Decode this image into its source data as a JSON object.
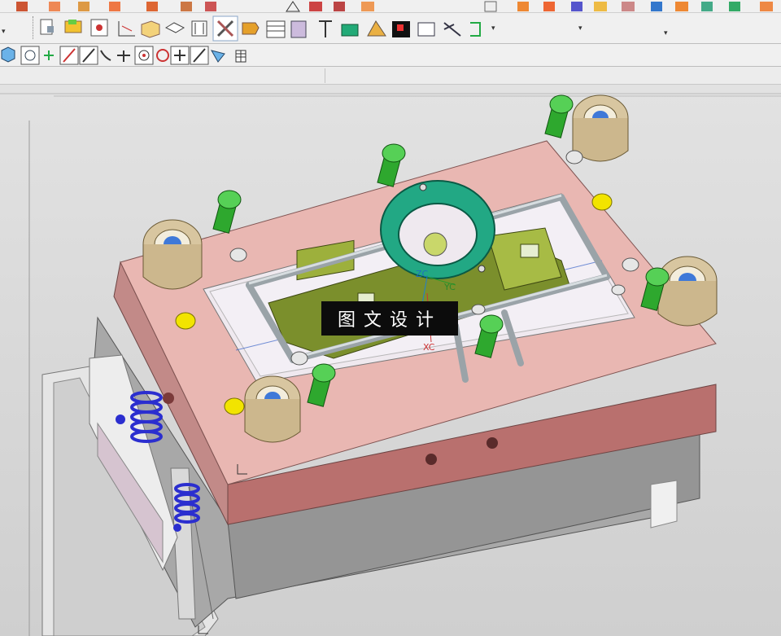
{
  "toolbar_row1": {
    "icons": [
      "mold-wizard-icon",
      "close-part-icon",
      "copy-part-icon",
      "layer-icon",
      "assembly-icon",
      "move-icon",
      "clone-icon",
      "sketch-icon",
      "triangle-icon",
      "mesh-icon",
      "scale-icon",
      "surface-icon",
      "extrude-icon",
      "shade-icon",
      "pipe-icon",
      "material-icon",
      "render-icon",
      "texture-icon"
    ]
  },
  "toolbar_row2": {
    "icons": [
      "project-init-icon",
      "part-family-icon",
      "mold-csys-icon",
      "shrinkage-icon",
      "workpiece-icon",
      "cavity-layout-icon",
      "multi-cavity-icon",
      "mold-tools-icon",
      "parting-icon",
      "mold-base-icon",
      "standard-parts-icon",
      "ejector-pin-icon",
      "ejector-post-icon",
      "slider-lifter-icon",
      "sub-insert-icon",
      "gate-icon",
      "runner-icon",
      "cooling-icon",
      "electrode-icon",
      "trim-icon",
      "pocket-icon",
      "bom-icon",
      "drawing-icon",
      "view-manager-icon",
      "delete-files-icon",
      "hole-table-icon"
    ],
    "active_icon": "mold-tools-icon"
  },
  "toolbar_row3": {
    "icons": [
      "cube-view-icon",
      "snap-points-icon",
      "point-icon",
      "line-icon",
      "arc-line-icon",
      "curve-icon",
      "intersection-icon",
      "circle-center-icon",
      "circle-icon",
      "cross-icon",
      "tangent-icon",
      "select-icon",
      "grid-icon"
    ]
  },
  "viewport": {
    "csys_labels": {
      "zc": "ZC",
      "yc": "YC",
      "xc": "XC"
    },
    "watermark": "图文设计"
  },
  "colors": {
    "a_plate": "#e9b7b2",
    "a_plate_side": "#b9706e",
    "b_plate": "#a9a9a9",
    "bolt": "#2ea82e",
    "bushing": "#d8c6a0",
    "locating_ring": "#22a884",
    "insert": "#7b8f2c",
    "spring": "#2b2ecf",
    "yellow_marker": "#f2e400"
  }
}
